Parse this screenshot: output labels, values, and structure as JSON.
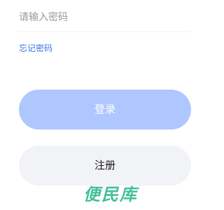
{
  "login_form": {
    "password_input": {
      "value": "",
      "placeholder": "请输入密码"
    },
    "forgot_password_label": "忘记密码",
    "login_button_label": "登录",
    "register_button_label": "注册"
  },
  "watermark": {
    "text": "便民库"
  },
  "colors": {
    "link": "#3a72e8",
    "login_button_bg": "#aec7ff",
    "register_button_bg": "#f2f3f7",
    "watermark": "#2fb98f"
  }
}
